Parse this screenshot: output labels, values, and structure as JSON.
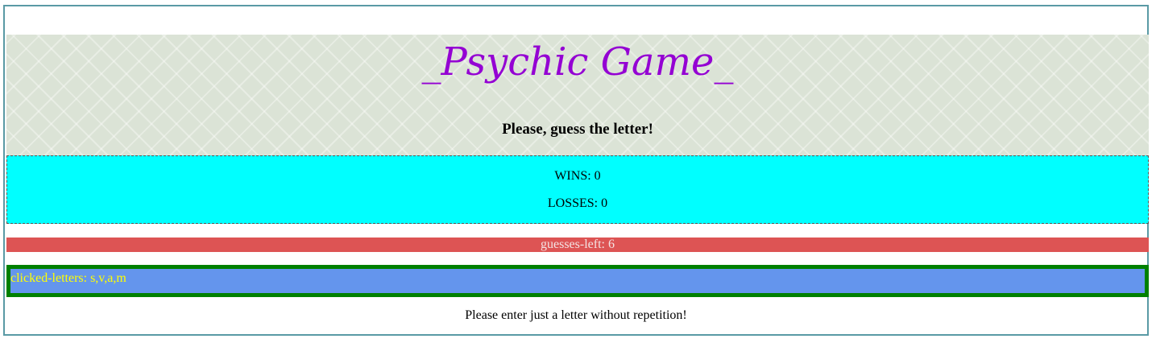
{
  "header": {
    "title": "_Psychic Game_",
    "subtitle": "Please, guess the letter!"
  },
  "scores": {
    "wins": "WINS: 0",
    "losses": "LOSSES: 0"
  },
  "guesses_left": "guesses-left: 6",
  "clicked_letters": "clicked-letters: s,v,a,m",
  "notice": "Please enter just a letter without repetition!",
  "colors": {
    "title": "#9400d3",
    "score_background": "#00ffff",
    "guesses_background": "#dd5454",
    "clicked_background": "#6495ed",
    "clicked_border": "#008000",
    "clicked_text": "#ffff00"
  }
}
